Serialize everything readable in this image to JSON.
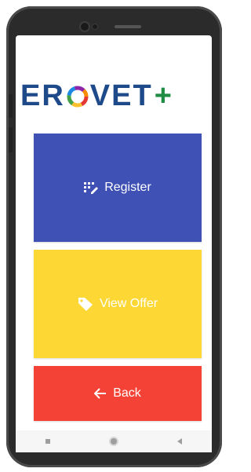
{
  "app": {
    "logo_text_left": "ER",
    "logo_text_right": "VET",
    "logo_plus": "+",
    "brand_color": "#1f4a8a",
    "plus_color": "#1e8c42"
  },
  "buttons": {
    "register_label": "Register",
    "register_icon": "registration-icon",
    "register_color": "#3f51b5",
    "offer_label": "View Offer",
    "offer_icon": "tag-icon",
    "offer_color": "#fdd835",
    "back_label": "Back",
    "back_icon": "arrow-left-icon",
    "back_color": "#f44336"
  },
  "navbar": {
    "items": [
      "recent-apps-icon",
      "home-icon",
      "back-nav-icon"
    ]
  }
}
